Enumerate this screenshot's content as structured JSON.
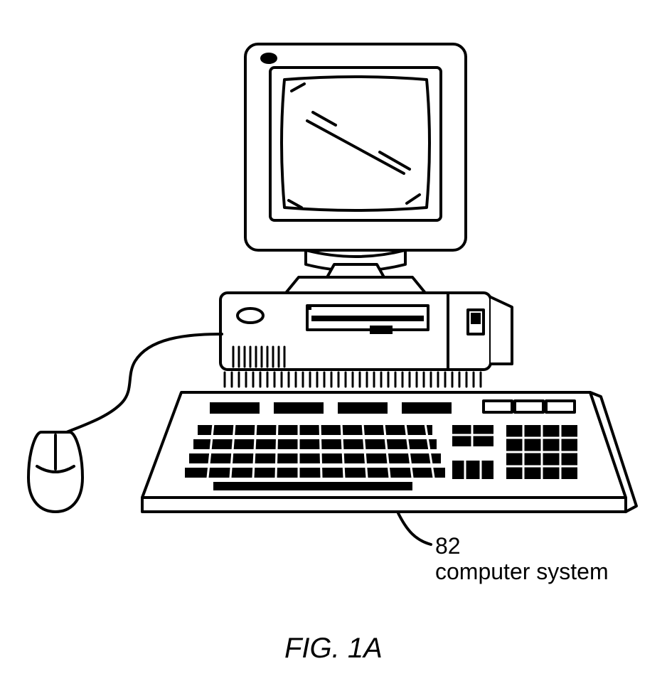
{
  "diagram": {
    "reference_number": "82",
    "reference_label": "computer system",
    "figure_caption": "FIG. 1A",
    "components": [
      "crt-monitor",
      "monitor-stand",
      "desktop-tower",
      "floppy-drive",
      "keyboard",
      "mouse",
      "mouse-cable"
    ]
  }
}
